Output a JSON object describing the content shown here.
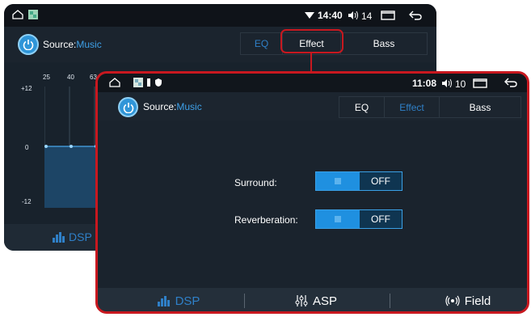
{
  "back_screen": {
    "status": {
      "time": "14:40",
      "volume": "14"
    },
    "source": {
      "label": "Source:",
      "value": "Music"
    },
    "tabs": [
      {
        "label": "EQ",
        "active": false
      },
      {
        "label": "Effect",
        "active": true
      },
      {
        "label": "Bass",
        "active": false
      }
    ],
    "eq": {
      "freq_labels": [
        "25",
        "40",
        "63"
      ],
      "y_labels": [
        "+12",
        "0",
        "-12"
      ]
    },
    "footer": {
      "dsp_label": "DSP"
    }
  },
  "front_screen": {
    "status": {
      "time": "11:08",
      "volume": "10"
    },
    "source": {
      "label": "Source:",
      "value": "Music"
    },
    "tabs": [
      {
        "label": "EQ",
        "active": false
      },
      {
        "label": "Effect",
        "active": true
      },
      {
        "label": "Bass",
        "active": false
      }
    ],
    "settings": [
      {
        "label": "Surround:",
        "state": "OFF"
      },
      {
        "label": "Reverberation:",
        "state": "OFF"
      }
    ],
    "footer": [
      {
        "label": "DSP",
        "icon": "bars-icon",
        "active": true
      },
      {
        "label": "ASP",
        "icon": "sliders-icon",
        "active": false
      },
      {
        "label": "Field",
        "icon": "broadcast-icon",
        "active": false
      }
    ]
  },
  "colors": {
    "accent": "#2f95d8",
    "highlight": "#c8181f",
    "inactive_text": "#2f80c8"
  }
}
